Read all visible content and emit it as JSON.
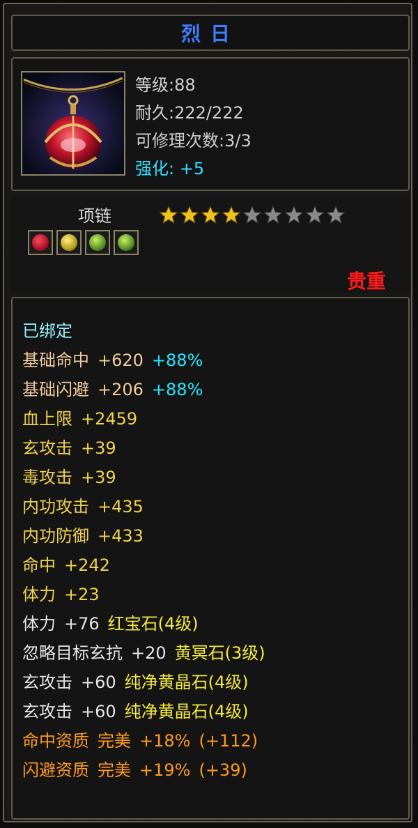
{
  "item": {
    "title": "烈日",
    "level": "等级:88",
    "durability": "耐久:222/222",
    "repairs": "可修理次数:3/3",
    "enhance_label": "强化:",
    "enhance_value": "+5",
    "type": "项链",
    "rarity": "贵重",
    "stars": {
      "filled": 4,
      "total": 9
    },
    "gem_slots": [
      "red-gem-icon",
      "yellow-gem-icon",
      "green-gem-icon",
      "green-gem-icon"
    ]
  },
  "stats": [
    {
      "parts": [
        "已绑定"
      ],
      "color": "cyan"
    },
    {
      "parts": [
        "基础命中",
        "+620"
      ],
      "extra": "+88%",
      "color": "peach"
    },
    {
      "parts": [
        "基础闪避",
        "+206"
      ],
      "extra": "+88%",
      "color": "peach"
    },
    {
      "parts": [
        "血上限",
        "+2459"
      ],
      "color": "yellow"
    },
    {
      "parts": [
        "玄攻击",
        "+39"
      ],
      "color": "yellow"
    },
    {
      "parts": [
        "毒攻击",
        "+39"
      ],
      "color": "yellow"
    },
    {
      "parts": [
        "内功攻击",
        "+435"
      ],
      "color": "yellow"
    },
    {
      "parts": [
        "内功防御",
        "+433"
      ],
      "color": "yellow"
    },
    {
      "parts": [
        "命中",
        "+242"
      ],
      "color": "yellow"
    },
    {
      "parts": [
        "体力",
        "+23"
      ],
      "color": "yellow"
    },
    {
      "parts": [
        "体力",
        "+76"
      ],
      "gem": "红宝石(4级)",
      "color": "white"
    },
    {
      "parts": [
        "忽略目标玄抗",
        "+20"
      ],
      "gem": "黄冥石(3级)",
      "color": "white"
    },
    {
      "parts": [
        "玄攻击",
        "+60"
      ],
      "gem": "纯净黄晶石(4级)",
      "color": "white"
    },
    {
      "parts": [
        "玄攻击",
        "+60"
      ],
      "gem": "纯净黄晶石(4级)",
      "color": "white"
    },
    {
      "parts": [
        "命中资质",
        "完美",
        "+18%",
        "(+112)"
      ],
      "color": "orange"
    },
    {
      "parts": [
        "闪避资质",
        "完美",
        "+19%",
        "(+39)"
      ],
      "color": "orange"
    }
  ],
  "colors": {
    "title": "#3d7dff",
    "enhance": "#33e0ff",
    "rarity": "#ff1a1a",
    "star_filled": "#f0c020",
    "star_empty": "#8a8a8a"
  }
}
